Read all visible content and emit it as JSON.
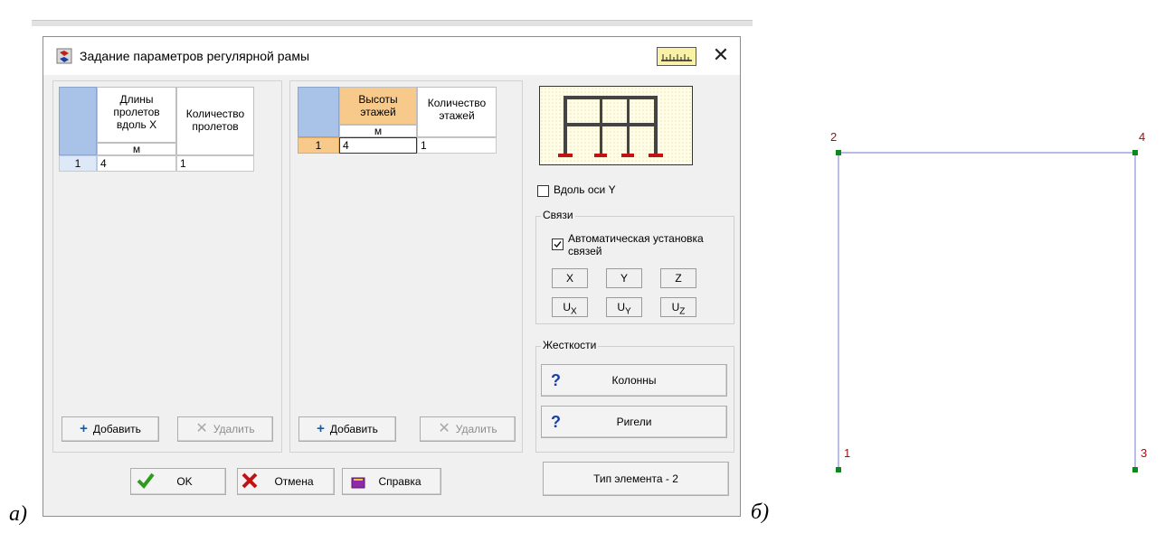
{
  "labels": {
    "a": "a)",
    "b": "б)"
  },
  "dialog": {
    "title": "Задание параметров регулярной рамы",
    "close_glyph": "✕",
    "icons": {
      "app": "app-logo-icon",
      "ruler": "ruler-icon",
      "close": "close-icon"
    }
  },
  "spans_table": {
    "headers": [
      "Длины пролетов вдоль X",
      "Количество пролетов"
    ],
    "unit": "м",
    "rows": [
      {
        "num": "1",
        "length": "4",
        "count": "1"
      }
    ],
    "add_label": "Добавить",
    "delete_label": "Удалить"
  },
  "floors_table": {
    "headers": [
      "Высоты этажей",
      "Количество этажей"
    ],
    "unit": "м",
    "rows": [
      {
        "num": "1",
        "height": "4",
        "count": "1"
      }
    ],
    "add_label": "Добавить",
    "delete_label": "Удалить"
  },
  "right_panel": {
    "along_y_label": "Вдоль оси Y",
    "along_y_checked": false,
    "links_group": "Связи",
    "auto_links_label": "Автоматическая установка связей",
    "auto_links_checked": true,
    "dofs": [
      "X",
      "Y",
      "Z",
      "Ux",
      "Uy",
      "Uz"
    ],
    "stiffness_group": "Жесткости",
    "columns_label": "Колонны",
    "beams_label": "Ригели",
    "question_glyph": "?",
    "element_type_label": "Тип элемента - 2"
  },
  "footer": {
    "ok_label": "OK",
    "cancel_label": "Отмена",
    "help_label": "Справка"
  },
  "frame_view": {
    "nodes": [
      {
        "id": "1"
      },
      {
        "id": "2"
      },
      {
        "id": "3"
      },
      {
        "id": "4"
      }
    ],
    "colors": {
      "line": "#8f8fd8",
      "node": "#0a8a1a",
      "label": "#a01010"
    }
  },
  "colors": {
    "accent_header": "#f7c98a",
    "row_highlight": "#f7c98a",
    "ok_check": "#2e9a1e",
    "cancel_x": "#c01414"
  }
}
